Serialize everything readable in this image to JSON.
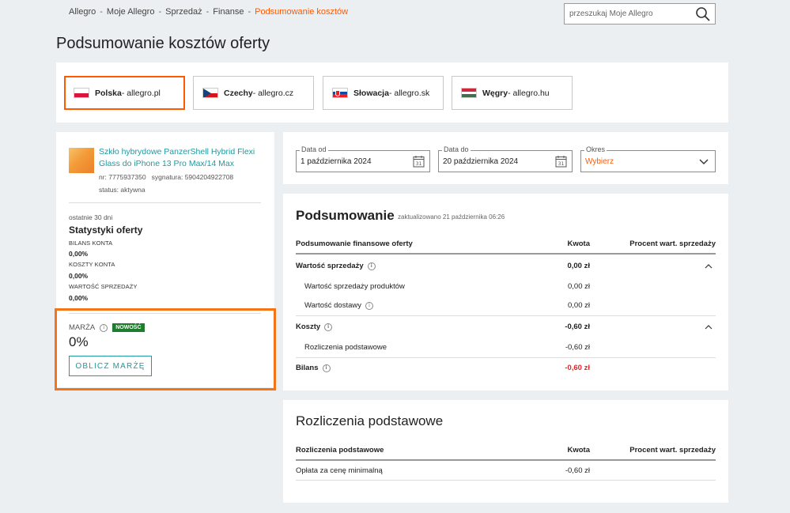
{
  "breadcrumb": {
    "items": [
      "Allegro",
      "Moje Allegro",
      "Sprzedaż",
      "Finanse"
    ],
    "current": "Podsumowanie kosztów",
    "separator": "-"
  },
  "search": {
    "placeholder": "przeszukaj Moje Allegro"
  },
  "page_title": "Podsumowanie kosztów oferty",
  "markets": [
    {
      "country": "Polska",
      "domain": " - allegro.pl",
      "active": true
    },
    {
      "country": "Czechy",
      "domain": " - allegro.cz",
      "active": false
    },
    {
      "country": "Słowacja",
      "domain": " - allegro.sk",
      "active": false
    },
    {
      "country": "Węgry",
      "domain": " - allegro.hu",
      "active": false
    }
  ],
  "product": {
    "title": "Szkło hybrydowe PanzerShell Hybrid Flexi Glass do iPhone 13 Pro Max/14 Max",
    "meta": "nr: 7775937350   sygnatura: 5904204922708",
    "status": "status: aktywna"
  },
  "stats": {
    "period": "ostatnie 30 dni",
    "title": "Statystyki oferty",
    "items": [
      {
        "label": "BILANS KONTA",
        "value": "0,00%"
      },
      {
        "label": "KOSZTY KONTA",
        "value": "0,00%"
      },
      {
        "label": "WARTOŚĆ SPRZEDAŻY",
        "value": "0,00%"
      }
    ]
  },
  "margin": {
    "label": "MARŻA",
    "badge": "NOWOŚĆ",
    "value": "0%",
    "button": "OBLICZ MARŻĘ"
  },
  "filters": {
    "date_from": {
      "label": "Data od",
      "value": "1 października 2024"
    },
    "date_to": {
      "label": "Data do",
      "value": "20 października 2024"
    },
    "period": {
      "label": "Okres",
      "value": "Wybierz"
    }
  },
  "summary": {
    "title": "Podsumowanie",
    "updated": "zaktualizowano 21 października 06:26",
    "headers": [
      "Podsumowanie finansowe oferty",
      "Kwota",
      "Procent wart. sprzedaży"
    ],
    "rows": [
      {
        "label": "Wartość sprzedaży",
        "value": "0,00 zł"
      },
      {
        "label": "Wartość sprzedaży produktów",
        "value": "0,00 zł"
      },
      {
        "label": "Wartość dostawy",
        "value": "0,00 zł"
      },
      {
        "label": "Koszty",
        "value": "-0,60 zł"
      },
      {
        "label": "Rozliczenia podstawowe",
        "value": "-0,60 zł"
      },
      {
        "label": "Bilans",
        "value": "-0,60 zł"
      }
    ]
  },
  "settlements": {
    "title": "Rozliczenia podstawowe",
    "headers": [
      "Rozliczenia podstawowe",
      "Kwota",
      "Procent wart. sprzedaży"
    ],
    "rows": [
      {
        "label": "Opłata za cenę minimalną",
        "value": "-0,60 zł"
      }
    ]
  },
  "colors": {
    "accent": "#ff5a00",
    "link": "#1f9aa0",
    "highlight_border": "#f57418",
    "negative": "#e4252b",
    "badge_bg": "#1e7d2c"
  }
}
